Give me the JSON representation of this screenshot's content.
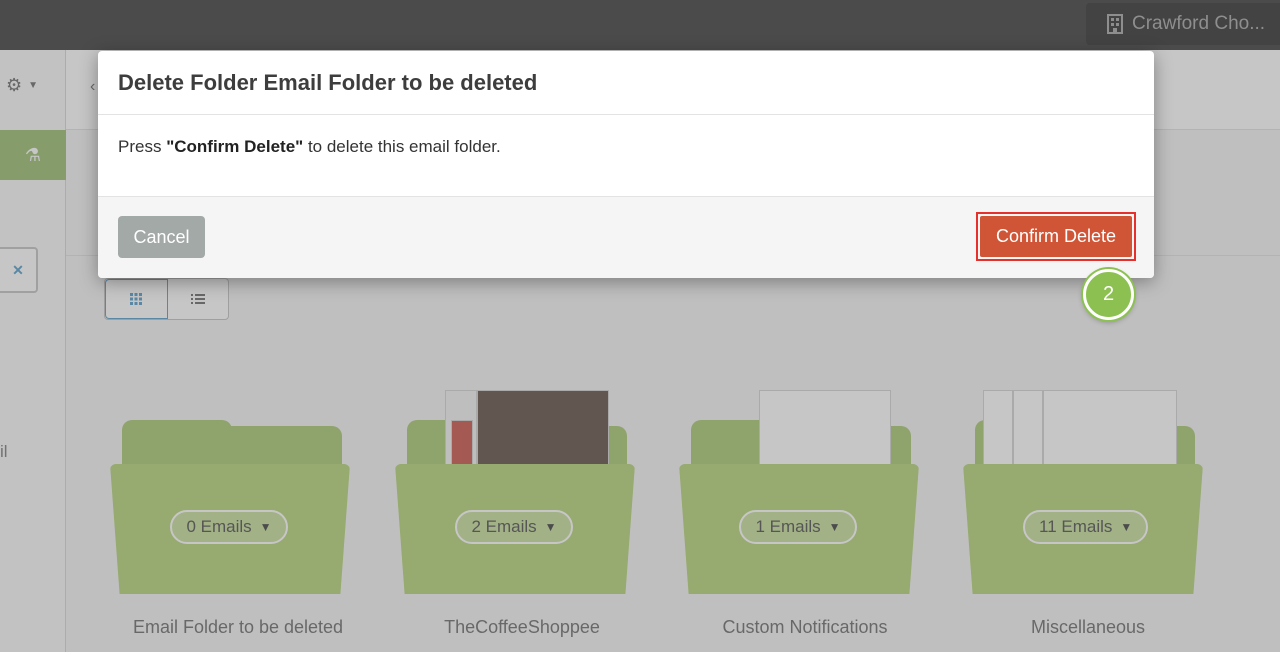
{
  "topbar": {
    "account_name": "Crawford Cho..."
  },
  "sidebar": {
    "partial_text": "il"
  },
  "folders": [
    {
      "count_label": "0 Emails",
      "name": "Email Folder to be deleted"
    },
    {
      "count_label": "2 Emails",
      "name": "TheCoffeeShoppee"
    },
    {
      "count_label": "1 Emails",
      "name": "Custom Notifications"
    },
    {
      "count_label": "11 Emails",
      "name": "Miscellaneous"
    }
  ],
  "modal": {
    "title": "Delete Folder Email Folder to be deleted",
    "body_prefix": "Press ",
    "body_bold": "\"Confirm Delete\"",
    "body_suffix": " to delete this email folder.",
    "cancel_label": "Cancel",
    "confirm_label": "Confirm Delete"
  },
  "step_marker": "2",
  "colors": {
    "accent_green": "#8cc152",
    "danger": "#d05536",
    "highlight": "#e5302b"
  }
}
